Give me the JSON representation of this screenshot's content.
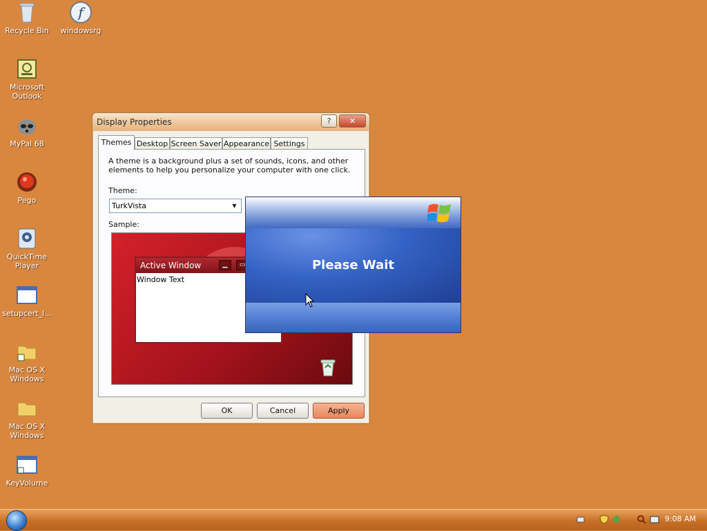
{
  "desktop": {
    "icons": [
      {
        "label": "Recycle Bin"
      },
      {
        "label": "windowsrg"
      },
      {
        "label": "Microsoft Outlook"
      },
      {
        "label": "MyPal 68"
      },
      {
        "label": "Pego"
      },
      {
        "label": "QuickTime Player"
      },
      {
        "label": "setupcert_l..."
      },
      {
        "label": "Mac OS X Windows"
      },
      {
        "label": "Mac OS X Windows"
      },
      {
        "label": "KeyVolume"
      }
    ]
  },
  "dialog": {
    "title": "Display Properties",
    "help_glyph": "?",
    "close_glyph": "✕",
    "tabs": [
      "Themes",
      "Desktop",
      "Screen Saver",
      "Appearance",
      "Settings"
    ],
    "description": "A theme is a background plus a set of sounds, icons, and other elements to help you personalize your computer with one click.",
    "theme_label": "Theme:",
    "theme_value": "TurkVista",
    "sample_label": "Sample:",
    "sample": {
      "active_window_title": "Active Window",
      "window_text": "Window Text"
    },
    "buttons": {
      "ok": "OK",
      "cancel": "Cancel",
      "apply": "Apply"
    }
  },
  "please_wait": {
    "message": "Please Wait"
  },
  "taskbar": {
    "clock": "9:08 AM"
  },
  "colors": {
    "desktop_bg": "#d9873f",
    "accent": "#2f5ab5"
  }
}
